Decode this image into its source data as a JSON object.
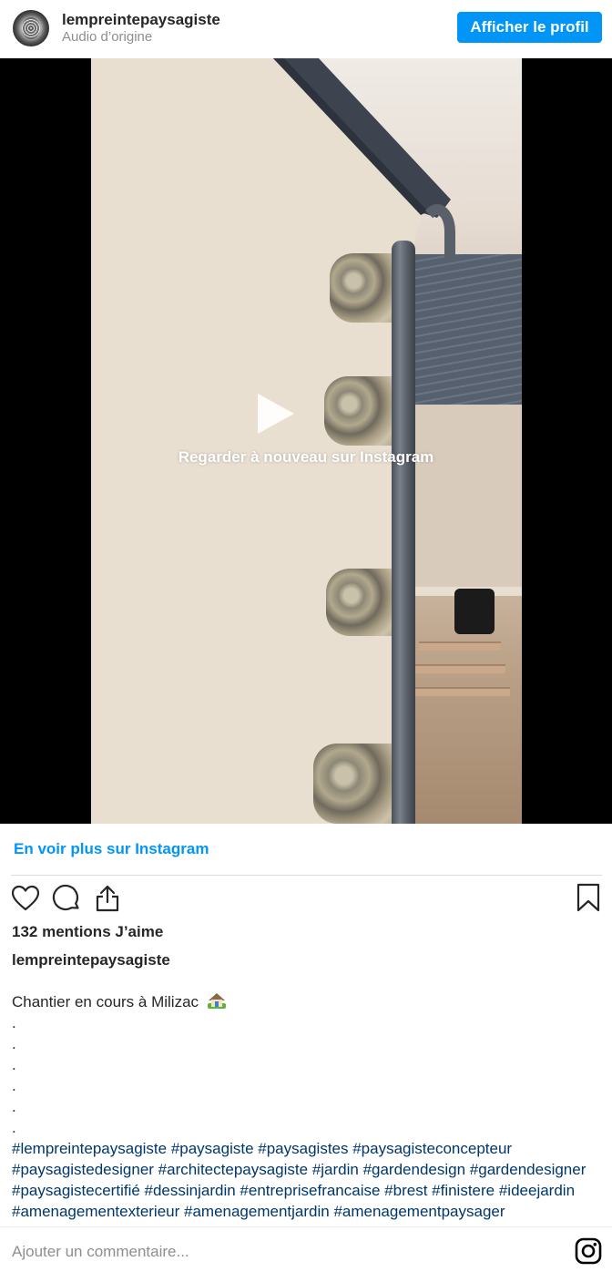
{
  "header": {
    "username": "lempreintepaysagiste",
    "subtitle": "Audio d’origine",
    "profile_button": "Afficher le profil"
  },
  "video": {
    "overlay_text": "Regarder à nouveau sur Instagram"
  },
  "links": {
    "see_more": "En voir plus sur Instagram"
  },
  "actions": {
    "icons": [
      "heart-icon",
      "comment-icon",
      "share-icon",
      "bookmark-icon"
    ]
  },
  "post": {
    "likes": "132 mentions J’aime",
    "caption_user": "lempreintepaysagiste",
    "caption_text": "Chantier en cours à Milizac",
    "dots": [
      ".",
      ".",
      ".",
      ".",
      ".",
      "."
    ],
    "hashtags": "#lempreintepaysagiste #paysagiste #paysagistes #paysagisteconcepteur #paysagistedesigner #architectepaysagiste #jardin #gardendesign #gardendesigner #paysagistecertifié #dessinjardin #entreprisefrancaise #brest #finistere #ideejardin #amenagementexterieur #amenagementjardin #amenagementpaysager"
  },
  "comment": {
    "placeholder": "Ajouter un commentaire..."
  },
  "colors": {
    "accent": "#0095f6",
    "text": "#262626",
    "muted": "#8e8e8e",
    "hashtag": "#00376b"
  }
}
